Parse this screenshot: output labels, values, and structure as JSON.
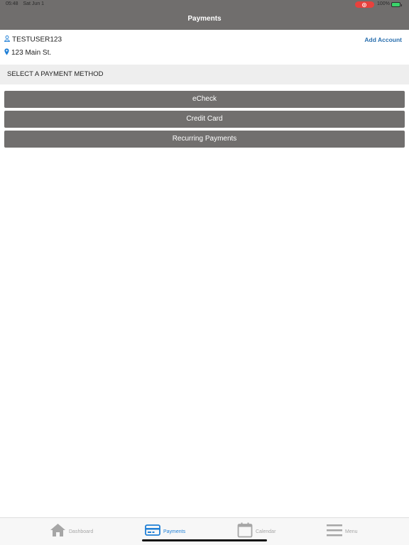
{
  "status_bar": {
    "time": "05:48",
    "date": "Sat Jun 1",
    "battery": "100%"
  },
  "header": {
    "title": "Payments"
  },
  "account": {
    "username": "TESTUSER123",
    "address": "123 Main St.",
    "add_account_label": "Add Account"
  },
  "section": {
    "label": "SELECT A PAYMENT METHOD"
  },
  "payment_methods": [
    "eCheck",
    "Credit Card",
    "Recurring Payments"
  ],
  "tabs": [
    {
      "label": "Dashboard",
      "icon": "home-icon"
    },
    {
      "label": "Payments",
      "icon": "credit-card-icon",
      "active": true
    },
    {
      "label": "Calendar",
      "icon": "calendar-icon"
    },
    {
      "label": "Menu",
      "icon": "hamburger-menu-icon"
    }
  ],
  "colors": {
    "header": "#706e6d",
    "button": "#716f6e",
    "link": "#2a6fae",
    "active_tab": "#1f7fd6",
    "inactive_tab": "#a6a6a6"
  }
}
